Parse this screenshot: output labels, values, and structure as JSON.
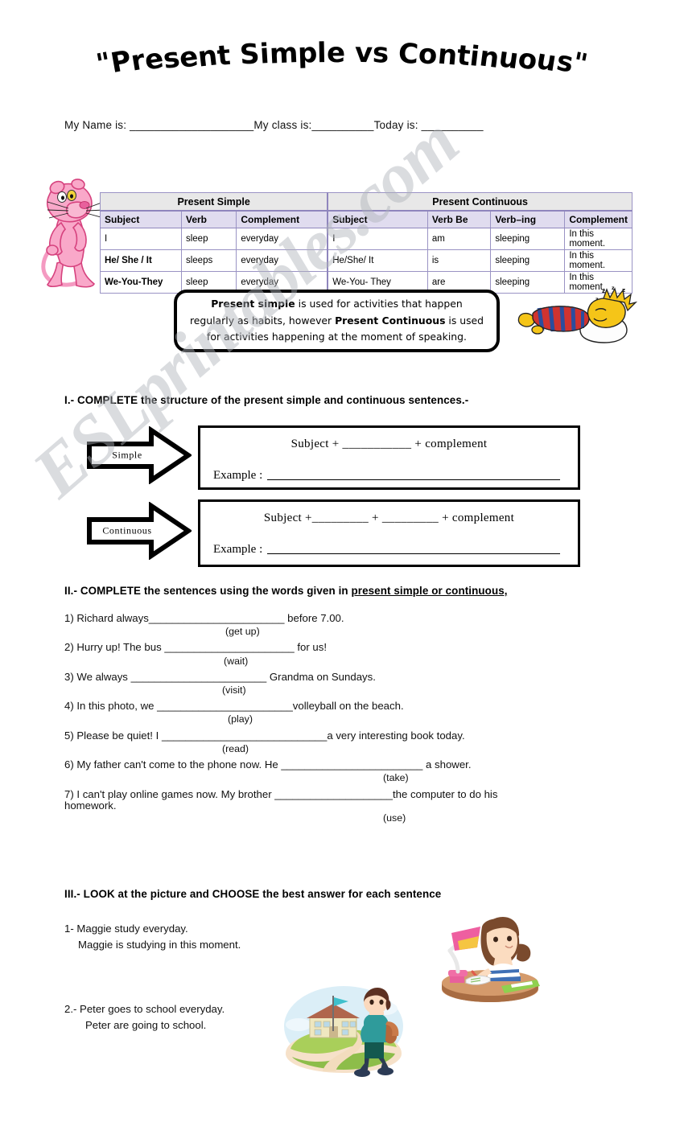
{
  "title": {
    "text": "\"Present Simple vs Continuous\""
  },
  "name_line": {
    "name_label": "My Name is: ",
    "name_blank": "____________________",
    "class_label": "My class is:",
    "class_blank": "__________",
    "date_label": "Today is: ",
    "date_blank": "__________"
  },
  "watermark": {
    "text": "ESLprintables.com"
  },
  "grammar_table": {
    "top_headers": [
      "Present Simple",
      "Present Continuous"
    ],
    "sub_headers": [
      "Subject",
      "Verb",
      "Complement",
      "Subject",
      "Verb Be",
      "Verb–ing",
      "Complement"
    ],
    "rows": [
      [
        "I",
        "sleep",
        "everyday",
        "I",
        "am",
        "sleeping",
        "In this moment."
      ],
      [
        "He/ She / It",
        "sleeps",
        "everyday",
        "He/She/ It",
        "is",
        "sleeping",
        "In this moment."
      ],
      [
        "We-You-They",
        "sleep",
        "everyday",
        "We-You- They",
        "are",
        "sleeping",
        "In this moment."
      ]
    ],
    "header_bg": "#e8e8e8",
    "subheader_bg": "#e0dcef",
    "border_color": "#9a93c4"
  },
  "callout": {
    "line1_bold": "Present simple",
    "line1_rest": " is used for activities that happen",
    "line2_pre": "regularly as habits, however ",
    "line2_bold": "Present Continuous",
    "line2_post": " is used",
    "line3": "for activities happening at the moment of speaking."
  },
  "section1": {
    "heading": "I.- COMPLETE the structure of the present simple and continuous sentences.-",
    "simple": {
      "arrow_label": "Simple",
      "formula": "Subject + ___________ + complement",
      "example_label": "Example :"
    },
    "continuous": {
      "arrow_label": "Continuous",
      "formula": "Subject +_________ + _________ + complement",
      "example_label": "Example :"
    }
  },
  "section2": {
    "heading_plain": "II.- COMPLETE the sentences using the words given in ",
    "heading_underlined": "present simple or continuous,",
    "items": [
      {
        "sentence": "1) Richard always_______________________ before 7.00.",
        "hint": "(get up)",
        "hint_indent": 200
      },
      {
        "sentence": "2) Hurry up! The bus  ______________________ for us!",
        "hint": "(wait)",
        "hint_indent": 198
      },
      {
        "sentence": "3)  We always  _______________________ Grandma on Sundays.",
        "hint": "(visit)",
        "hint_indent": 196
      },
      {
        "sentence": "4) In this photo, we _______________________volleyball on the beach.",
        "hint": "(play)",
        "hint_indent": 203
      },
      {
        "sentence": "5) Please be quiet! I ____________________________a very interesting book today.",
        "hint": "(read)",
        "hint_indent": 196
      },
      {
        "sentence": "6)  My father can't come to the phone now. He ________________________ a shower.",
        "hint": "(take)",
        "hint_indent": 396
      },
      {
        "sentence": "7) I can't play online games now. My brother ____________________the computer to do his",
        "sentence2": "homework.",
        "hint": "(use)",
        "hint_indent": 396
      }
    ]
  },
  "section3": {
    "heading": "III.- LOOK at the picture and CHOOSE the best answer for each sentence",
    "q1": {
      "a": "1- Maggie study everyday.",
      "b": "Maggie is studying in this moment."
    },
    "q2": {
      "a": "2.-   Peter goes to school everyday.",
      "b": "Peter are going to school."
    }
  },
  "illustrations": {
    "panther": "pink-panther-character",
    "bart": "bart-simpson-sleeping",
    "girl": "girl-studying-at-desk",
    "boy": "boy-walking-to-school"
  }
}
